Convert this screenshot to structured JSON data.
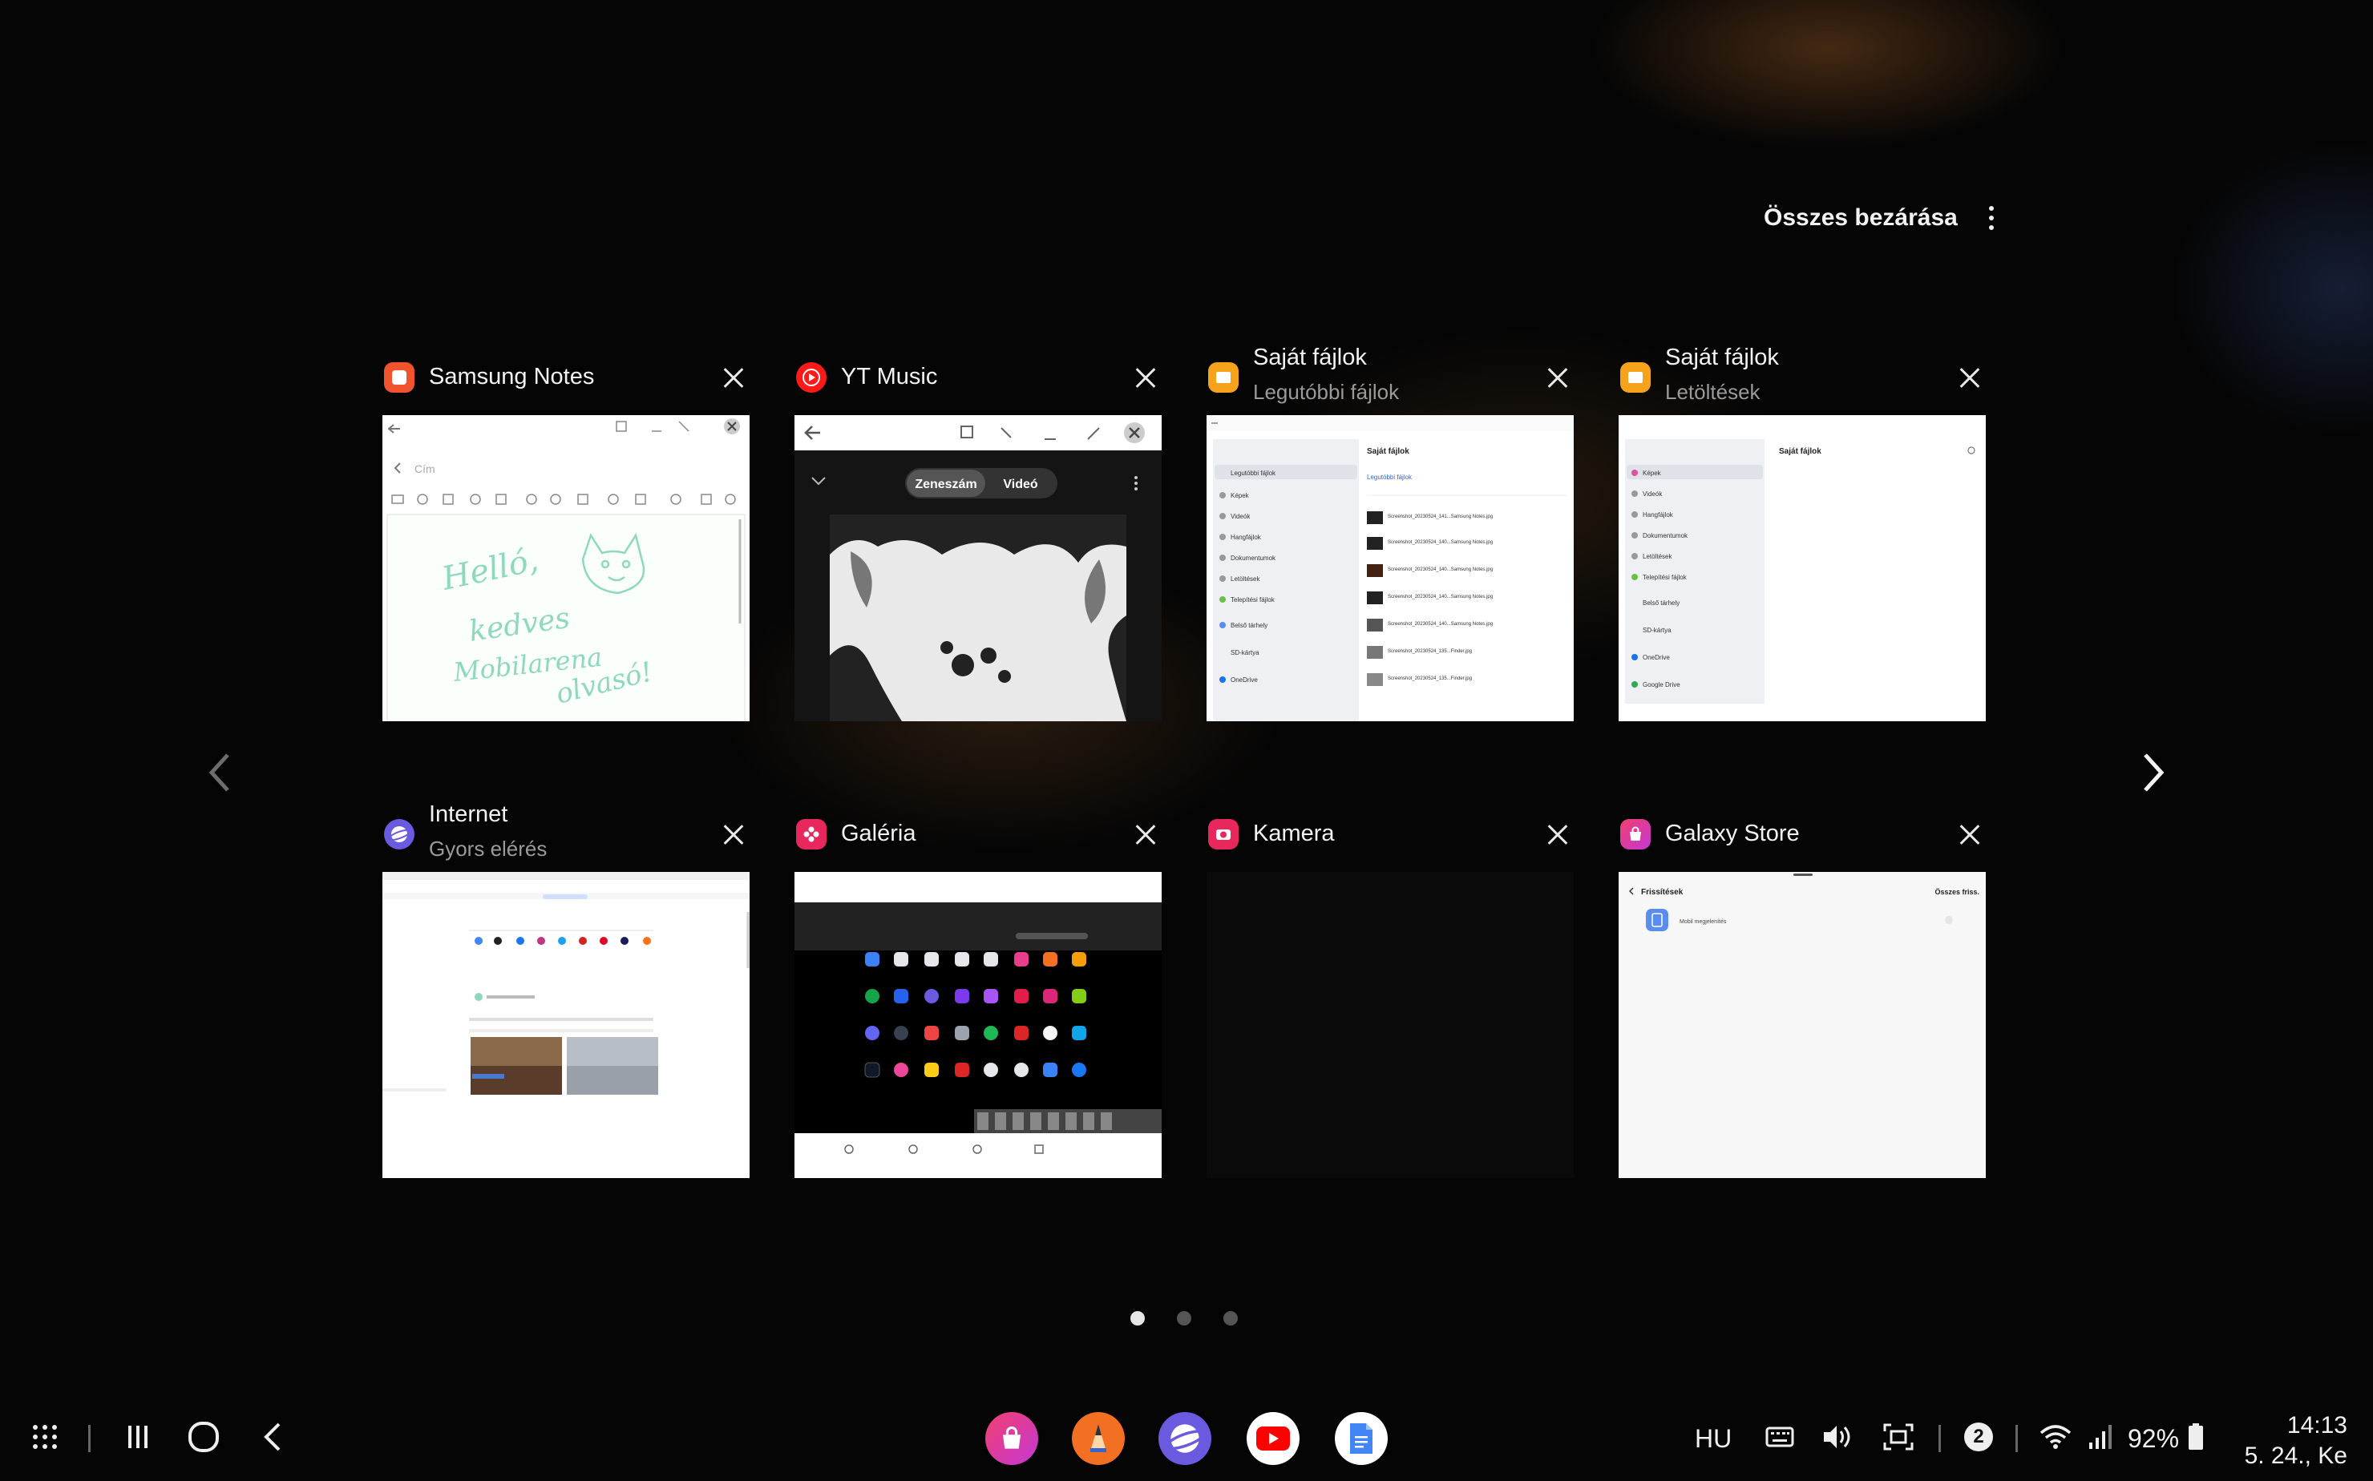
{
  "header": {
    "close_all_label": "Összes bezárása"
  },
  "cards": [
    {
      "name": "Samsung Notes",
      "sub": "",
      "icon_color": "#f0532d",
      "icon": "notes-icon"
    },
    {
      "name": "YT Music",
      "sub": "",
      "icon_color": "#ff1a1a",
      "icon": "yt-music-icon"
    },
    {
      "name": "Saját fájlok",
      "sub": "Legutóbbi fájlok",
      "icon_color": "#f6a21b",
      "icon": "folder-icon"
    },
    {
      "name": "Saját fájlok",
      "sub": "Letöltések",
      "icon_color": "#f6a21b",
      "icon": "folder-icon"
    },
    {
      "name": "Internet",
      "sub": "Gyors elérés",
      "icon_color": "#6a5ae0",
      "icon": "internet-icon"
    },
    {
      "name": "Galéria",
      "sub": "",
      "icon_color": "#e8285d",
      "icon": "gallery-icon"
    },
    {
      "name": "Kamera",
      "sub": "",
      "icon_color": "#e8285d",
      "icon": "camera-icon"
    },
    {
      "name": "Galaxy Store",
      "sub": "",
      "icon_color": "#e83e8c",
      "icon": "galaxy-store-icon"
    }
  ],
  "notes_thumb": {
    "title_placeholder": "Cím",
    "handwriting": [
      "Helló,",
      "kedves",
      "Mobilarena",
      "olvasó!"
    ]
  },
  "ytmusic_thumb": {
    "tab_song": "Zeneszám",
    "tab_video": "Videó"
  },
  "files_recent_thumb": {
    "title": "Saját fájlok",
    "section": "Legutóbbi fájlok",
    "sidebar": [
      "Legutóbbi fájlok",
      "Képek",
      "Videók",
      "Hangfájlok",
      "Dokumentumok",
      "Letöltések",
      "Telepítési fájlok",
      "Belső tárhely",
      "SD-kártya",
      "OneDrive"
    ],
    "files": [
      "Screenshot_20230524_141...Samsung Notes.jpg",
      "Screenshot_20230524_140...Samsung Notes.jpg",
      "Screenshot_20230524_140...Samsung Notes.jpg",
      "Screenshot_20230524_140...Samsung Notes.jpg",
      "Screenshot_20230524_140...Samsung Notes.jpg",
      "Screenshot_20230524_135...Finder.jpg",
      "Screenshot_20230524_135...Finder.jpg"
    ]
  },
  "files_downloads_thumb": {
    "title": "Saját fájlok",
    "sidebar": [
      "Képek",
      "Videók",
      "Hangfájlok",
      "Dokumentumok",
      "Letöltések",
      "Telepítési fájlok",
      "Belső tárhely",
      "SD-kártya",
      "OneDrive",
      "Google Drive"
    ]
  },
  "store_thumb": {
    "title": "Frissítések",
    "update_all": "Összes friss.",
    "item": "Mobil megjelenítés"
  },
  "status": {
    "language": "HU",
    "notification_count": "2",
    "battery": "92%",
    "time": "14:13",
    "date": "5. 24., Ke"
  },
  "dock": [
    {
      "icon": "galaxy-store-dock-icon",
      "color": "#e83e8c"
    },
    {
      "icon": "pen-up-dock-icon",
      "color": "#f36f21"
    },
    {
      "icon": "internet-dock-icon",
      "color": "#6a5ae0"
    },
    {
      "icon": "youtube-dock-icon",
      "color": "#ffffff"
    },
    {
      "icon": "google-docs-dock-icon",
      "color": "#ffffff"
    }
  ]
}
